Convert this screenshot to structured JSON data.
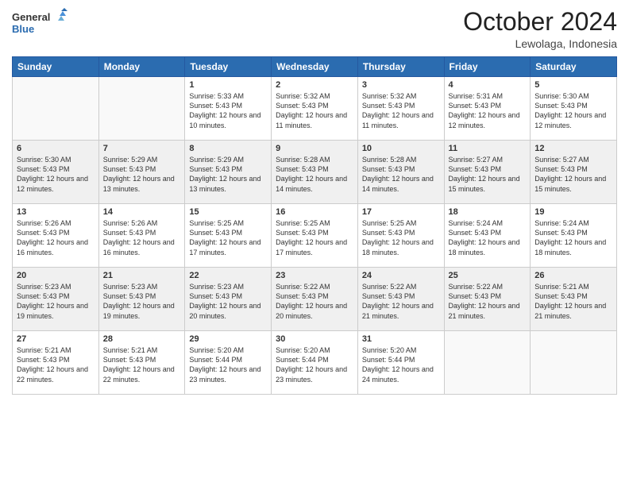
{
  "header": {
    "logo_general": "General",
    "logo_blue": "Blue",
    "month": "October 2024",
    "location": "Lewolaga, Indonesia"
  },
  "days_of_week": [
    "Sunday",
    "Monday",
    "Tuesday",
    "Wednesday",
    "Thursday",
    "Friday",
    "Saturday"
  ],
  "weeks": [
    [
      {
        "day": "",
        "info": ""
      },
      {
        "day": "",
        "info": ""
      },
      {
        "day": "1",
        "info": "Sunrise: 5:33 AM\nSunset: 5:43 PM\nDaylight: 12 hours and 10 minutes."
      },
      {
        "day": "2",
        "info": "Sunrise: 5:32 AM\nSunset: 5:43 PM\nDaylight: 12 hours and 11 minutes."
      },
      {
        "day": "3",
        "info": "Sunrise: 5:32 AM\nSunset: 5:43 PM\nDaylight: 12 hours and 11 minutes."
      },
      {
        "day": "4",
        "info": "Sunrise: 5:31 AM\nSunset: 5:43 PM\nDaylight: 12 hours and 12 minutes."
      },
      {
        "day": "5",
        "info": "Sunrise: 5:30 AM\nSunset: 5:43 PM\nDaylight: 12 hours and 12 minutes."
      }
    ],
    [
      {
        "day": "6",
        "info": "Sunrise: 5:30 AM\nSunset: 5:43 PM\nDaylight: 12 hours and 12 minutes."
      },
      {
        "day": "7",
        "info": "Sunrise: 5:29 AM\nSunset: 5:43 PM\nDaylight: 12 hours and 13 minutes."
      },
      {
        "day": "8",
        "info": "Sunrise: 5:29 AM\nSunset: 5:43 PM\nDaylight: 12 hours and 13 minutes."
      },
      {
        "day": "9",
        "info": "Sunrise: 5:28 AM\nSunset: 5:43 PM\nDaylight: 12 hours and 14 minutes."
      },
      {
        "day": "10",
        "info": "Sunrise: 5:28 AM\nSunset: 5:43 PM\nDaylight: 12 hours and 14 minutes."
      },
      {
        "day": "11",
        "info": "Sunrise: 5:27 AM\nSunset: 5:43 PM\nDaylight: 12 hours and 15 minutes."
      },
      {
        "day": "12",
        "info": "Sunrise: 5:27 AM\nSunset: 5:43 PM\nDaylight: 12 hours and 15 minutes."
      }
    ],
    [
      {
        "day": "13",
        "info": "Sunrise: 5:26 AM\nSunset: 5:43 PM\nDaylight: 12 hours and 16 minutes."
      },
      {
        "day": "14",
        "info": "Sunrise: 5:26 AM\nSunset: 5:43 PM\nDaylight: 12 hours and 16 minutes."
      },
      {
        "day": "15",
        "info": "Sunrise: 5:25 AM\nSunset: 5:43 PM\nDaylight: 12 hours and 17 minutes."
      },
      {
        "day": "16",
        "info": "Sunrise: 5:25 AM\nSunset: 5:43 PM\nDaylight: 12 hours and 17 minutes."
      },
      {
        "day": "17",
        "info": "Sunrise: 5:25 AM\nSunset: 5:43 PM\nDaylight: 12 hours and 18 minutes."
      },
      {
        "day": "18",
        "info": "Sunrise: 5:24 AM\nSunset: 5:43 PM\nDaylight: 12 hours and 18 minutes."
      },
      {
        "day": "19",
        "info": "Sunrise: 5:24 AM\nSunset: 5:43 PM\nDaylight: 12 hours and 18 minutes."
      }
    ],
    [
      {
        "day": "20",
        "info": "Sunrise: 5:23 AM\nSunset: 5:43 PM\nDaylight: 12 hours and 19 minutes."
      },
      {
        "day": "21",
        "info": "Sunrise: 5:23 AM\nSunset: 5:43 PM\nDaylight: 12 hours and 19 minutes."
      },
      {
        "day": "22",
        "info": "Sunrise: 5:23 AM\nSunset: 5:43 PM\nDaylight: 12 hours and 20 minutes."
      },
      {
        "day": "23",
        "info": "Sunrise: 5:22 AM\nSunset: 5:43 PM\nDaylight: 12 hours and 20 minutes."
      },
      {
        "day": "24",
        "info": "Sunrise: 5:22 AM\nSunset: 5:43 PM\nDaylight: 12 hours and 21 minutes."
      },
      {
        "day": "25",
        "info": "Sunrise: 5:22 AM\nSunset: 5:43 PM\nDaylight: 12 hours and 21 minutes."
      },
      {
        "day": "26",
        "info": "Sunrise: 5:21 AM\nSunset: 5:43 PM\nDaylight: 12 hours and 21 minutes."
      }
    ],
    [
      {
        "day": "27",
        "info": "Sunrise: 5:21 AM\nSunset: 5:43 PM\nDaylight: 12 hours and 22 minutes."
      },
      {
        "day": "28",
        "info": "Sunrise: 5:21 AM\nSunset: 5:43 PM\nDaylight: 12 hours and 22 minutes."
      },
      {
        "day": "29",
        "info": "Sunrise: 5:20 AM\nSunset: 5:44 PM\nDaylight: 12 hours and 23 minutes."
      },
      {
        "day": "30",
        "info": "Sunrise: 5:20 AM\nSunset: 5:44 PM\nDaylight: 12 hours and 23 minutes."
      },
      {
        "day": "31",
        "info": "Sunrise: 5:20 AM\nSunset: 5:44 PM\nDaylight: 12 hours and 24 minutes."
      },
      {
        "day": "",
        "info": ""
      },
      {
        "day": "",
        "info": ""
      }
    ]
  ]
}
